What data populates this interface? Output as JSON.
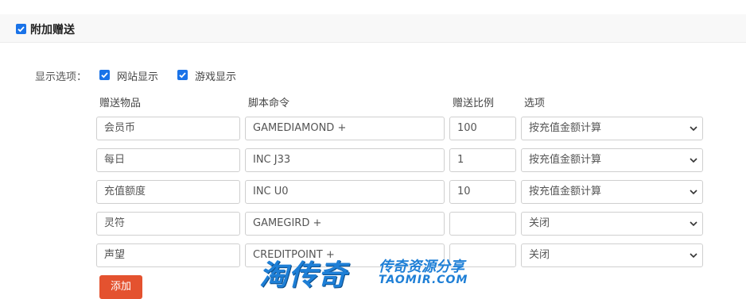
{
  "section": {
    "title": "附加赠送",
    "checked": true
  },
  "display_options": {
    "label": "显示选项：",
    "items": [
      {
        "label": "网站显示",
        "checked": true
      },
      {
        "label": "游戏显示",
        "checked": true
      }
    ]
  },
  "columns": {
    "item": "赠送物品",
    "command": "脚本命令",
    "ratio": "赠送比例",
    "option": "选项"
  },
  "rows": [
    {
      "item": "会员币",
      "command": "GAMEDIAMOND +",
      "ratio": "100",
      "option": "按充值金额计算"
    },
    {
      "item": "每日",
      "command": "INC J33",
      "ratio": "1",
      "option": "按充值金额计算"
    },
    {
      "item": "充值额度",
      "command": "INC U0",
      "ratio": "10",
      "option": "按充值金额计算"
    },
    {
      "item": "灵符",
      "command": "GAMEGIRD +",
      "ratio": "",
      "option": "关闭"
    },
    {
      "item": "声望",
      "command": "CREDITPOINT +",
      "ratio": "",
      "option": "关闭"
    }
  ],
  "add_button": "添加",
  "watermark": {
    "brand": "淘传奇",
    "tagline": "传奇资源分享",
    "url": "TAOMIR.COM"
  },
  "colors": {
    "accent": "#1a73e8",
    "add_button": "#e4522f",
    "watermark": "#1e7fd6"
  }
}
